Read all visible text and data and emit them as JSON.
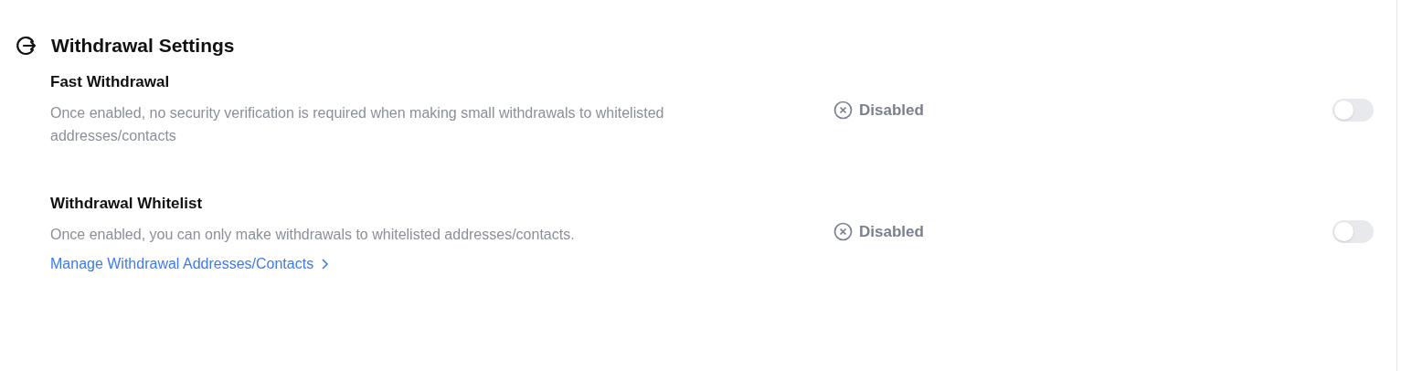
{
  "section": {
    "title": "Withdrawal Settings"
  },
  "settings": [
    {
      "title": "Fast Withdrawal",
      "description": "Once enabled, no security verification is required when making small withdrawals to whitelisted addresses/contacts",
      "status": "Disabled",
      "on": false
    },
    {
      "title": "Withdrawal Whitelist",
      "description": "Once enabled, you can only make withdrawals to whitelisted addresses/contacts.",
      "link": "Manage Withdrawal Addresses/Contacts",
      "status": "Disabled",
      "on": false
    }
  ]
}
